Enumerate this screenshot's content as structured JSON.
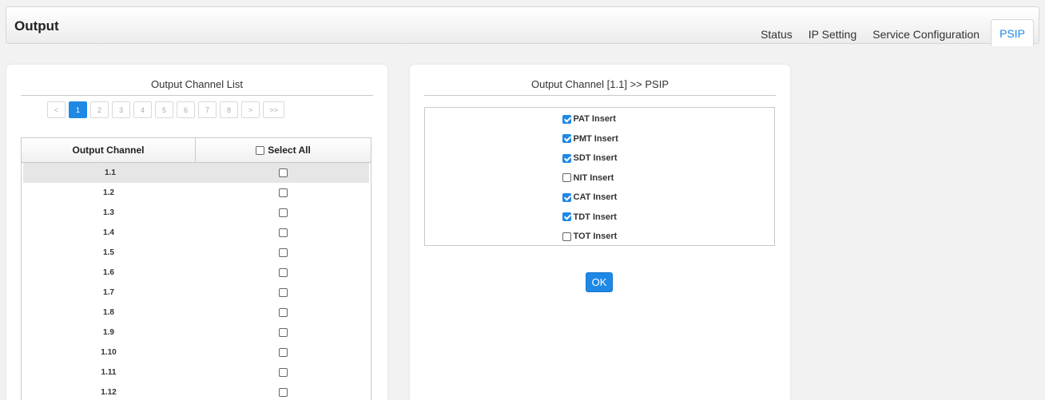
{
  "header": {
    "title": "Output",
    "tabs": [
      {
        "label": "Status",
        "active": false
      },
      {
        "label": "IP Setting",
        "active": false
      },
      {
        "label": "Service Configuration",
        "active": false
      },
      {
        "label": "PSIP",
        "active": true
      }
    ]
  },
  "left_panel": {
    "title": "Output Channel List",
    "pager": {
      "prev": "<",
      "pages": [
        "1",
        "2",
        "3",
        "4",
        "5",
        "6",
        "7",
        "8"
      ],
      "current": "1",
      "next": ">",
      "last": ">>"
    },
    "table": {
      "col_channel": "Output Channel",
      "col_select_all": "Select All",
      "select_all_checked": false,
      "rows": [
        {
          "channel": "1.1",
          "checked": false,
          "selected": true
        },
        {
          "channel": "1.2",
          "checked": false
        },
        {
          "channel": "1.3",
          "checked": false
        },
        {
          "channel": "1.4",
          "checked": false
        },
        {
          "channel": "1.5",
          "checked": false
        },
        {
          "channel": "1.6",
          "checked": false
        },
        {
          "channel": "1.7",
          "checked": false
        },
        {
          "channel": "1.8",
          "checked": false
        },
        {
          "channel": "1.9",
          "checked": false
        },
        {
          "channel": "1.10",
          "checked": false
        },
        {
          "channel": "1.11",
          "checked": false
        },
        {
          "channel": "1.12",
          "checked": false
        }
      ]
    }
  },
  "right_panel": {
    "title": "Output Channel  [1.1] >> PSIP",
    "options": [
      {
        "label": "PAT Insert",
        "checked": true
      },
      {
        "label": "PMT Insert",
        "checked": true
      },
      {
        "label": "SDT Insert",
        "checked": true
      },
      {
        "label": "NIT Insert",
        "checked": false
      },
      {
        "label": "CAT Insert",
        "checked": true
      },
      {
        "label": "TDT Insert",
        "checked": true
      },
      {
        "label": "TOT Insert",
        "checked": false
      }
    ],
    "ok_label": "OK"
  },
  "colors": {
    "accent": "#1e88e5",
    "background": "#f2f2f2",
    "panel": "#ffffff"
  }
}
